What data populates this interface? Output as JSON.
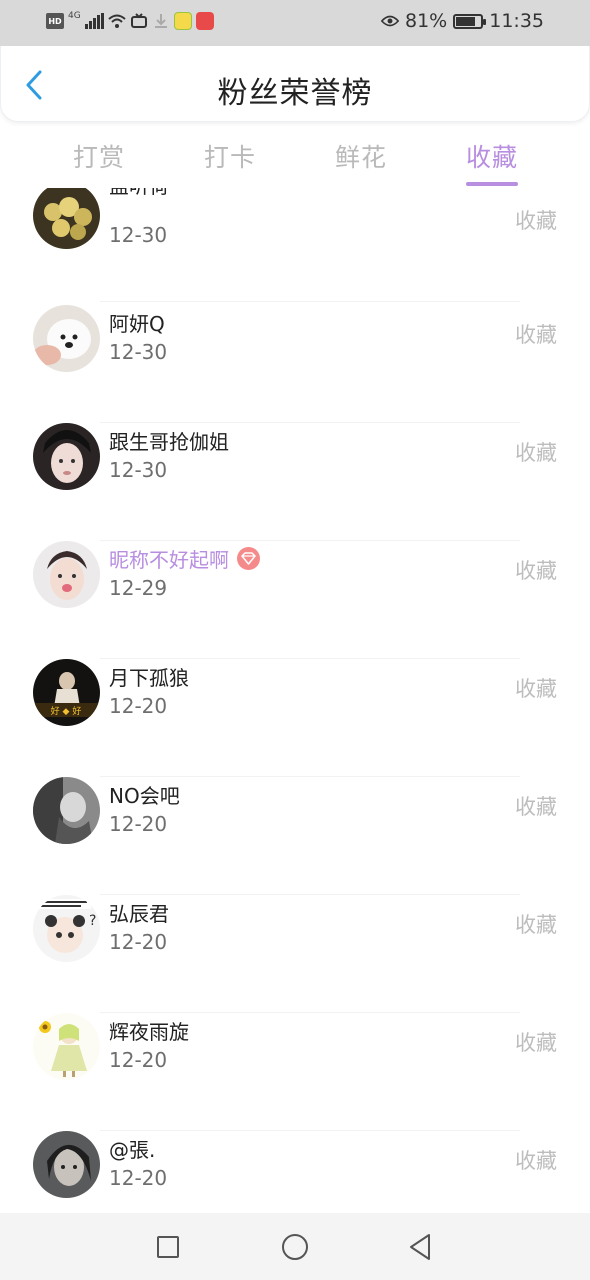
{
  "status_bar": {
    "badge": "HD",
    "signal": "4G",
    "battery": "81%",
    "battery_level": 0.81,
    "time": "11:35"
  },
  "header": {
    "title": "粉丝荣誉榜"
  },
  "tabs": [
    {
      "label": "打赏",
      "active": false
    },
    {
      "label": "打卡",
      "active": false
    },
    {
      "label": "鲜花",
      "active": false
    },
    {
      "label": "收藏",
      "active": true
    }
  ],
  "fans": [
    {
      "name": "盐听荷",
      "date": "12-30",
      "action": "收藏"
    },
    {
      "name": "阿妍Q",
      "date": "12-30",
      "action": "收藏"
    },
    {
      "name": "跟生哥抢伽姐",
      "date": "12-30",
      "action": "收藏"
    },
    {
      "name": "昵称不好起啊",
      "date": "12-29",
      "action": "收藏"
    },
    {
      "name": "月下孤狼",
      "date": "12-20",
      "action": "收藏"
    },
    {
      "name": "NO会吧",
      "date": "12-20",
      "action": "收藏"
    },
    {
      "name": "弘辰君",
      "date": "12-20",
      "action": "收藏"
    },
    {
      "name": "辉夜雨旋",
      "date": "12-20",
      "action": "收藏"
    },
    {
      "name": "@張.",
      "date": "12-20",
      "action": "收藏"
    }
  ],
  "colors": {
    "accent": "#b88ee0",
    "back_arrow": "#2f9be0",
    "vip_badge": "#f58a8a"
  }
}
